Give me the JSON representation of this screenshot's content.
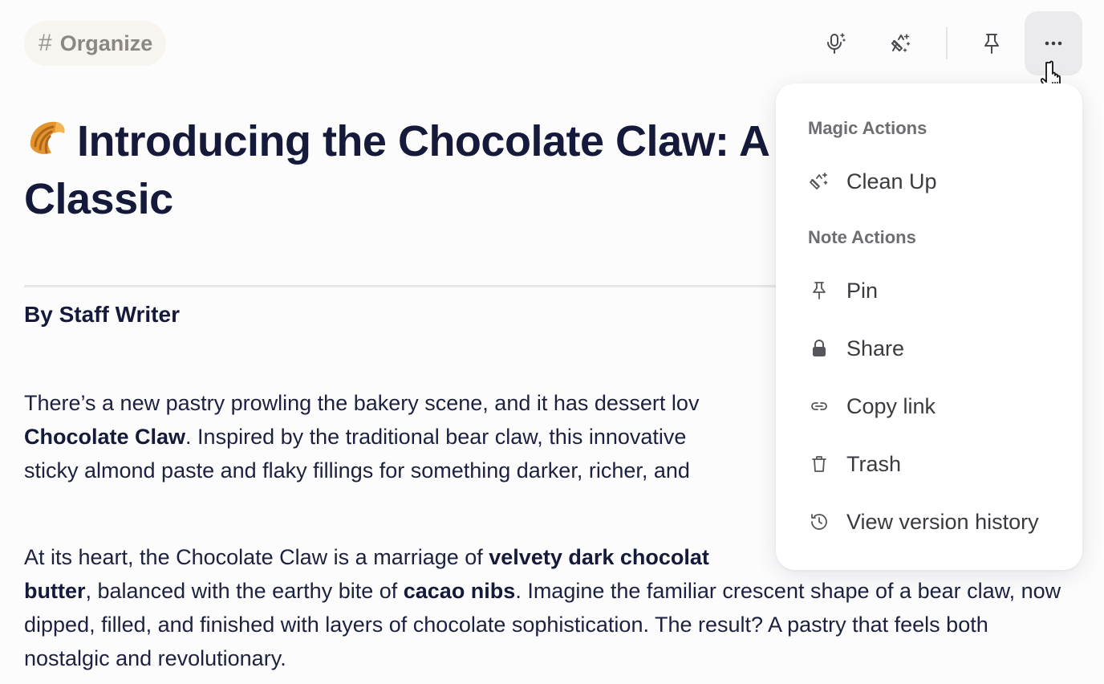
{
  "tag": {
    "symbol": "#",
    "label": "Organize"
  },
  "toolbar": {
    "icons": [
      "microphone-sparkle-icon",
      "clean-up-sparkle-icon",
      "pin-icon",
      "more-icon"
    ]
  },
  "note": {
    "title_emoji": "croissant-icon",
    "title": "Introducing the Chocolate Claw: A Twist on a Classic",
    "byline": "By Staff Writer",
    "p1": {
      "t1": "There’s a new pastry prowling the bakery scene, and it has dessert lov",
      "b1": "Chocolate Claw",
      "t2": ". Inspired by the traditional bear claw, this innovative",
      "t3": "sticky almond paste and flaky fillings for something darker, richer, and"
    },
    "p2": {
      "t1": "At its heart, the Chocolate Claw is a marriage of ",
      "b1": "velvety dark chocolat",
      "b2": "butter",
      "t2": ", balanced with the earthy bite of ",
      "b3": "cacao nibs",
      "t3": ". Imagine the familiar crescent shape of a bear claw, now dipped, filled, and finished with layers of chocolate sophistication. The result? A pastry that feels both nostalgic and revolutionary."
    }
  },
  "menu": {
    "magic_header": "Magic Actions",
    "clean_up": "Clean Up",
    "note_header": "Note Actions",
    "pin": "Pin",
    "share": "Share",
    "copy_link": "Copy link",
    "trash": "Trash",
    "version_history": "View version history"
  },
  "colors": {
    "title": "#151a3a",
    "chip_bg": "#f8f4ef",
    "menu_bg": "#ffffff",
    "active_button_bg": "#ebebee"
  }
}
